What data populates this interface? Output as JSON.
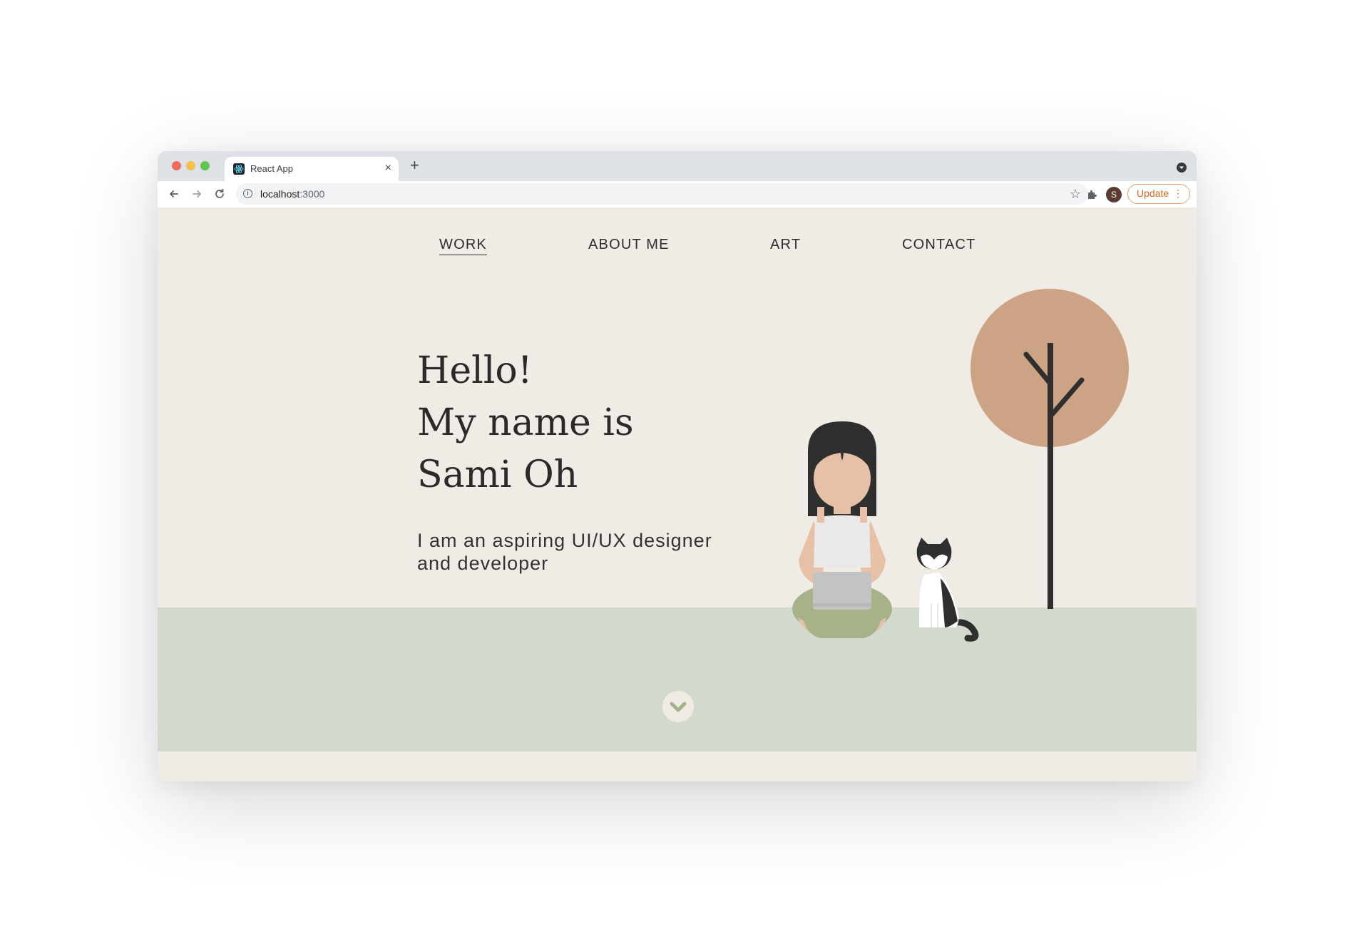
{
  "browser": {
    "tab_title": "React App",
    "tab_close": "×",
    "new_tab": "+",
    "url_host": "localhost",
    "url_port": ":3000",
    "profile_initial": "S",
    "update_label": "Update",
    "update_menu": "⋮",
    "star": "☆",
    "info": "i"
  },
  "nav": {
    "items": [
      {
        "label": "WORK",
        "active": true
      },
      {
        "label": "ABOUT ME"
      },
      {
        "label": "ART"
      },
      {
        "label": "CONTACT"
      }
    ]
  },
  "hero": {
    "line1": "Hello!",
    "line2": "My name is",
    "line3": "Sami Oh",
    "subtitle": "I am an aspiring UI/UX designer and developer"
  },
  "colors": {
    "background": "#f0ebe4",
    "ground": "#d2dacd",
    "tree_canopy": "#cda386",
    "pants": "#a8b289",
    "laptop": "#c3c3c3"
  }
}
